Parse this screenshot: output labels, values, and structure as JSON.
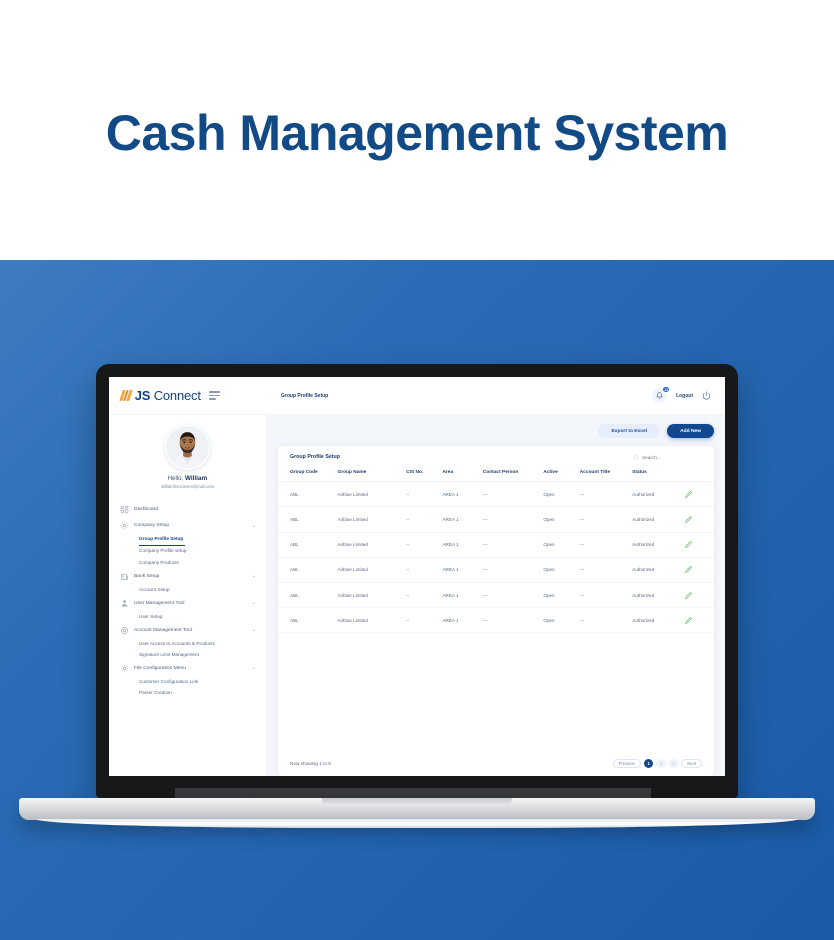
{
  "hero": {
    "title": "Cash Management System"
  },
  "app": {
    "brand": {
      "bold": "JS",
      "light": "Connect"
    },
    "breadcrumb": "Group Profile Setup",
    "topbar": {
      "notification_count": "13",
      "logout_label": "Logout"
    },
    "profile": {
      "greeting_prefix": "Hello,",
      "name": "William",
      "email": "williamfroncieson@mail.com"
    },
    "nav": [
      {
        "label": "Dashboard",
        "icon": "dashboard-icon",
        "expandable": false,
        "children": []
      },
      {
        "label": "Company Setup",
        "icon": "company-icon",
        "expandable": true,
        "children": [
          {
            "label": "Group Profile Setup",
            "active": true
          },
          {
            "label": "Company Profile setup",
            "active": false
          },
          {
            "label": "Company Products",
            "active": false
          }
        ]
      },
      {
        "label": "Bank Setup",
        "icon": "bank-icon",
        "expandable": true,
        "children": [
          {
            "label": "Account Setup",
            "active": false
          }
        ]
      },
      {
        "label": "User Management Tool",
        "icon": "user-icon",
        "expandable": true,
        "children": [
          {
            "label": "User Setup",
            "active": false
          }
        ]
      },
      {
        "label": "Account Management Tool",
        "icon": "account-icon",
        "expandable": true,
        "children": [
          {
            "label": "User Access to Accounts & Products",
            "active": false
          },
          {
            "label": "Signature Limit Management",
            "active": false
          }
        ]
      },
      {
        "label": "File Configuration Menu",
        "icon": "gear-icon",
        "expandable": true,
        "children": [
          {
            "label": "Customer Configuration Link",
            "active": false
          },
          {
            "label": "Parser Creation",
            "active": false
          }
        ]
      }
    ],
    "actions": {
      "export_label": "Export to Excel",
      "add_label": "Add New"
    },
    "card": {
      "title": "Group Profile Setup",
      "search_placeholder": "Search...",
      "columns": [
        "Group Code",
        "Group Name",
        "CIS No.",
        "Area",
        "Contact Person",
        "Active",
        "Account Title",
        "Status",
        ""
      ],
      "rows": [
        {
          "group_code": "ABL",
          "group_name": "Airblue Limited",
          "cis_no": "--",
          "area": "AREA 1",
          "contact_person": "---",
          "active": "Open",
          "account_title": "---",
          "status": "Authorized",
          "action": "edit-icon"
        },
        {
          "group_code": "ABL",
          "group_name": "Airblue Limited",
          "cis_no": "--",
          "area": "AREA 1",
          "contact_person": "---",
          "active": "Open",
          "account_title": "---",
          "status": "Authorized",
          "action": "edit-icon"
        },
        {
          "group_code": "ABL",
          "group_name": "Airblue Limited",
          "cis_no": "--",
          "area": "AREA 1",
          "contact_person": "---",
          "active": "Open",
          "account_title": "---",
          "status": "Authorized",
          "action": "edit-icon"
        },
        {
          "group_code": "ABL",
          "group_name": "Airblue Limited",
          "cis_no": "--",
          "area": "AREA 1",
          "contact_person": "---",
          "active": "Open",
          "account_title": "---",
          "status": "Authorized",
          "action": "edit-icon"
        },
        {
          "group_code": "ABL",
          "group_name": "Airblue Limited",
          "cis_no": "--",
          "area": "AREA 1",
          "contact_person": "---",
          "active": "Open",
          "account_title": "---",
          "status": "Authorized",
          "action": "edit-icon"
        },
        {
          "group_code": "ABL",
          "group_name": "Airblue Limited",
          "cis_no": "--",
          "area": "AREA 1",
          "contact_person": "---",
          "active": "Open",
          "account_title": "---",
          "status": "Authorized",
          "action": "edit-icon"
        }
      ],
      "footer": {
        "showing": "Now showing 1 to 6",
        "previous_label": "Previous",
        "next_label": "Next",
        "pages": [
          "1",
          "2",
          "3"
        ],
        "current_page": "1"
      }
    }
  },
  "colors": {
    "brand_blue": "#14427e",
    "primary": "#11478c",
    "accent_orange": "#e8812a",
    "page_blue": "#2a6cb5",
    "status_green": "#4caf50"
  }
}
